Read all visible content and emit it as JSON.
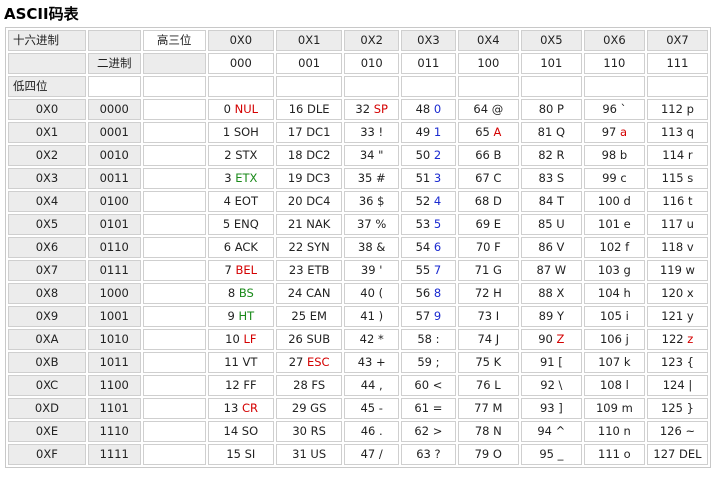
{
  "title": "ASCII码表",
  "colors": {
    "header_bg": "#ececec",
    "cell_bg": "#ffffff",
    "border": "#cfcfcf",
    "red": "#d40000",
    "green": "#1a8a1a",
    "blue": "#1a2ad0"
  },
  "header": {
    "corner_top": "十六进制",
    "corner_binary": "二进制",
    "high_label": "高三位",
    "low_label": "低四位",
    "hex_cols": [
      "0X0",
      "0X1",
      "0X2",
      "0X3",
      "0X4",
      "0X5",
      "0X6",
      "0X7"
    ],
    "bin_cols": [
      "000",
      "001",
      "010",
      "011",
      "100",
      "101",
      "110",
      "111"
    ]
  },
  "rows": [
    {
      "hex": "0X0",
      "bin": "0000",
      "cells": [
        [
          "0",
          "NUL",
          "red"
        ],
        [
          "16",
          "DLE",
          ""
        ],
        [
          "32",
          "SP",
          "red"
        ],
        [
          "48",
          "0",
          "blu"
        ],
        [
          "64",
          "@",
          ""
        ],
        [
          "80",
          "P",
          ""
        ],
        [
          "96",
          "`",
          ""
        ],
        [
          "112",
          "p",
          ""
        ]
      ]
    },
    {
      "hex": "0X1",
      "bin": "0001",
      "cells": [
        [
          "1",
          "SOH",
          ""
        ],
        [
          "17",
          "DC1",
          ""
        ],
        [
          "33",
          "!",
          ""
        ],
        [
          "49",
          "1",
          "blu"
        ],
        [
          "65",
          "A",
          "red"
        ],
        [
          "81",
          "Q",
          ""
        ],
        [
          "97",
          "a",
          "red"
        ],
        [
          "113",
          "q",
          ""
        ]
      ]
    },
    {
      "hex": "0X2",
      "bin": "0010",
      "cells": [
        [
          "2",
          "STX",
          ""
        ],
        [
          "18",
          "DC2",
          ""
        ],
        [
          "34",
          "\"",
          ""
        ],
        [
          "50",
          "2",
          "blu"
        ],
        [
          "66",
          "B",
          ""
        ],
        [
          "82",
          "R",
          ""
        ],
        [
          "98",
          "b",
          ""
        ],
        [
          "114",
          "r",
          ""
        ]
      ]
    },
    {
      "hex": "0X3",
      "bin": "0011",
      "cells": [
        [
          "3",
          "ETX",
          "grn"
        ],
        [
          "19",
          "DC3",
          ""
        ],
        [
          "35",
          "#",
          ""
        ],
        [
          "51",
          "3",
          "blu"
        ],
        [
          "67",
          "C",
          ""
        ],
        [
          "83",
          "S",
          ""
        ],
        [
          "99",
          "c",
          ""
        ],
        [
          "115",
          "s",
          ""
        ]
      ]
    },
    {
      "hex": "0X4",
      "bin": "0100",
      "cells": [
        [
          "4",
          "EOT",
          ""
        ],
        [
          "20",
          "DC4",
          ""
        ],
        [
          "36",
          "$",
          ""
        ],
        [
          "52",
          "4",
          "blu"
        ],
        [
          "68",
          "D",
          ""
        ],
        [
          "84",
          "T",
          ""
        ],
        [
          "100",
          "d",
          ""
        ],
        [
          "116",
          "t",
          ""
        ]
      ]
    },
    {
      "hex": "0X5",
      "bin": "0101",
      "cells": [
        [
          "5",
          "ENQ",
          ""
        ],
        [
          "21",
          "NAK",
          ""
        ],
        [
          "37",
          "%",
          ""
        ],
        [
          "53",
          "5",
          "blu"
        ],
        [
          "69",
          "E",
          ""
        ],
        [
          "85",
          "U",
          ""
        ],
        [
          "101",
          "e",
          ""
        ],
        [
          "117",
          "u",
          ""
        ]
      ]
    },
    {
      "hex": "0X6",
      "bin": "0110",
      "cells": [
        [
          "6",
          "ACK",
          ""
        ],
        [
          "22",
          "SYN",
          ""
        ],
        [
          "38",
          "&",
          ""
        ],
        [
          "54",
          "6",
          "blu"
        ],
        [
          "70",
          "F",
          ""
        ],
        [
          "86",
          "V",
          ""
        ],
        [
          "102",
          "f",
          ""
        ],
        [
          "118",
          "v",
          ""
        ]
      ]
    },
    {
      "hex": "0X7",
      "bin": "0111",
      "cells": [
        [
          "7",
          "BEL",
          "red"
        ],
        [
          "23",
          "ETB",
          ""
        ],
        [
          "39",
          "'",
          ""
        ],
        [
          "55",
          "7",
          "blu"
        ],
        [
          "71",
          "G",
          ""
        ],
        [
          "87",
          "W",
          ""
        ],
        [
          "103",
          "g",
          ""
        ],
        [
          "119",
          "w",
          ""
        ]
      ]
    },
    {
      "hex": "0X8",
      "bin": "1000",
      "cells": [
        [
          "8",
          "BS",
          "grn"
        ],
        [
          "24",
          "CAN",
          ""
        ],
        [
          "40",
          "(",
          ""
        ],
        [
          "56",
          "8",
          "blu"
        ],
        [
          "72",
          "H",
          ""
        ],
        [
          "88",
          "X",
          ""
        ],
        [
          "104",
          "h",
          ""
        ],
        [
          "120",
          "x",
          ""
        ]
      ]
    },
    {
      "hex": "0X9",
      "bin": "1001",
      "cells": [
        [
          "9",
          "HT",
          "grn"
        ],
        [
          "25",
          "EM",
          ""
        ],
        [
          "41",
          ")",
          ""
        ],
        [
          "57",
          "9",
          "blu"
        ],
        [
          "73",
          "I",
          ""
        ],
        [
          "89",
          "Y",
          ""
        ],
        [
          "105",
          "i",
          ""
        ],
        [
          "121",
          "y",
          ""
        ]
      ]
    },
    {
      "hex": "0XA",
      "bin": "1010",
      "cells": [
        [
          "10",
          "LF",
          "red"
        ],
        [
          "26",
          "SUB",
          ""
        ],
        [
          "42",
          "*",
          ""
        ],
        [
          "58",
          ":",
          ""
        ],
        [
          "74",
          "J",
          ""
        ],
        [
          "90",
          "Z",
          "red"
        ],
        [
          "106",
          "j",
          ""
        ],
        [
          "122",
          "z",
          "red"
        ]
      ]
    },
    {
      "hex": "0XB",
      "bin": "1011",
      "cells": [
        [
          "11",
          "VT",
          ""
        ],
        [
          "27",
          "ESC",
          "red"
        ],
        [
          "43",
          "+",
          ""
        ],
        [
          "59",
          ";",
          ""
        ],
        [
          "75",
          "K",
          ""
        ],
        [
          "91",
          "[",
          ""
        ],
        [
          "107",
          "k",
          ""
        ],
        [
          "123",
          "{",
          ""
        ]
      ]
    },
    {
      "hex": "0XC",
      "bin": "1100",
      "cells": [
        [
          "12",
          "FF",
          ""
        ],
        [
          "28",
          "FS",
          ""
        ],
        [
          "44",
          ",",
          ""
        ],
        [
          "60",
          "<",
          ""
        ],
        [
          "76",
          "L",
          ""
        ],
        [
          "92",
          "\\",
          ""
        ],
        [
          "108",
          "l",
          ""
        ],
        [
          "124",
          "|",
          ""
        ]
      ]
    },
    {
      "hex": "0XD",
      "bin": "1101",
      "cells": [
        [
          "13",
          "CR",
          "red"
        ],
        [
          "29",
          "GS",
          ""
        ],
        [
          "45",
          "-",
          ""
        ],
        [
          "61",
          "=",
          ""
        ],
        [
          "77",
          "M",
          ""
        ],
        [
          "93",
          "]",
          ""
        ],
        [
          "109",
          "m",
          ""
        ],
        [
          "125",
          "}",
          ""
        ]
      ]
    },
    {
      "hex": "0XE",
      "bin": "1110",
      "cells": [
        [
          "14",
          "SO",
          ""
        ],
        [
          "30",
          "RS",
          ""
        ],
        [
          "46",
          ".",
          ""
        ],
        [
          "62",
          ">",
          ""
        ],
        [
          "78",
          "N",
          ""
        ],
        [
          "94",
          "^",
          ""
        ],
        [
          "110",
          "n",
          ""
        ],
        [
          "126",
          "~",
          ""
        ]
      ]
    },
    {
      "hex": "0XF",
      "bin": "1111",
      "cells": [
        [
          "15",
          "SI",
          ""
        ],
        [
          "31",
          "US",
          ""
        ],
        [
          "47",
          "/",
          ""
        ],
        [
          "63",
          "?",
          ""
        ],
        [
          "79",
          "O",
          ""
        ],
        [
          "95",
          "_",
          ""
        ],
        [
          "111",
          "o",
          ""
        ],
        [
          "127",
          "DEL",
          ""
        ]
      ]
    }
  ]
}
